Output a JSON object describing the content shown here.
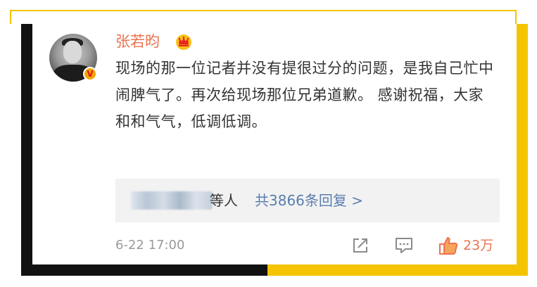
{
  "post": {
    "username": "张若昀",
    "text": "现场的那一位记者并没有提很过分的问题，是我自己忙中闹脾气了。再次给现场那位兄弟道歉。 感谢祝福，大家和和气气，低调低调。",
    "replies": {
      "suffix": "等人",
      "link": "共3866条回复 >"
    },
    "timestamp": "6-22 17:00",
    "likes": "23万"
  },
  "icons": {
    "crown": "crown-icon",
    "verified": "verified-badge-icon",
    "share": "share-icon",
    "comment": "comment-icon",
    "like": "thumbs-up-icon"
  },
  "colors": {
    "accent_orange": "#eb7350",
    "link_blue": "#5a7dae",
    "frame_yellow": "#f5c400",
    "frame_black": "#111111"
  }
}
